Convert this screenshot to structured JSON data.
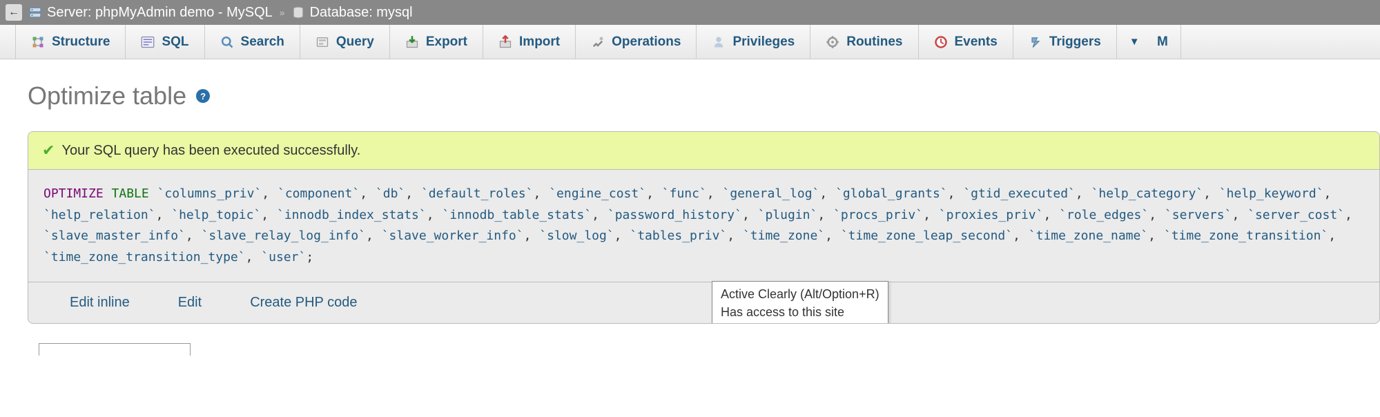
{
  "breadcrumb": {
    "server_label": "Server: phpMyAdmin demo - MySQL",
    "database_label": "Database: mysql"
  },
  "tabs": [
    {
      "icon": "structure",
      "label": "Structure"
    },
    {
      "icon": "sql",
      "label": "SQL"
    },
    {
      "icon": "search",
      "label": "Search"
    },
    {
      "icon": "query",
      "label": "Query"
    },
    {
      "icon": "export",
      "label": "Export"
    },
    {
      "icon": "import",
      "label": "Import"
    },
    {
      "icon": "operations",
      "label": "Operations"
    },
    {
      "icon": "privileges",
      "label": "Privileges"
    },
    {
      "icon": "routines",
      "label": "Routines"
    },
    {
      "icon": "events",
      "label": "Events"
    },
    {
      "icon": "triggers",
      "label": "Triggers"
    }
  ],
  "page_title": "Optimize table",
  "success_message": "Your SQL query has been executed successfully.",
  "sql": {
    "keyword1": "OPTIMIZE",
    "keyword2": "TABLE",
    "tables": [
      "columns_priv",
      "component",
      "db",
      "default_roles",
      "engine_cost",
      "func",
      "general_log",
      "global_grants",
      "gtid_executed",
      "help_category",
      "help_keyword",
      "help_relation",
      "help_topic",
      "innodb_index_stats",
      "innodb_table_stats",
      "password_history",
      "plugin",
      "procs_priv",
      "proxies_priv",
      "role_edges",
      "servers",
      "server_cost",
      "slave_master_info",
      "slave_relay_log_info",
      "slave_worker_info",
      "slow_log",
      "tables_priv",
      "time_zone",
      "time_zone_leap_second",
      "time_zone_name",
      "time_zone_transition",
      "time_zone_transition_type",
      "user"
    ]
  },
  "actions": {
    "edit_inline": "Edit inline",
    "edit": "Edit",
    "create_php": "Create PHP code"
  },
  "tooltip": {
    "line1": "Active Clearly (Alt/Option+R)",
    "line2": "Has access to this site"
  }
}
